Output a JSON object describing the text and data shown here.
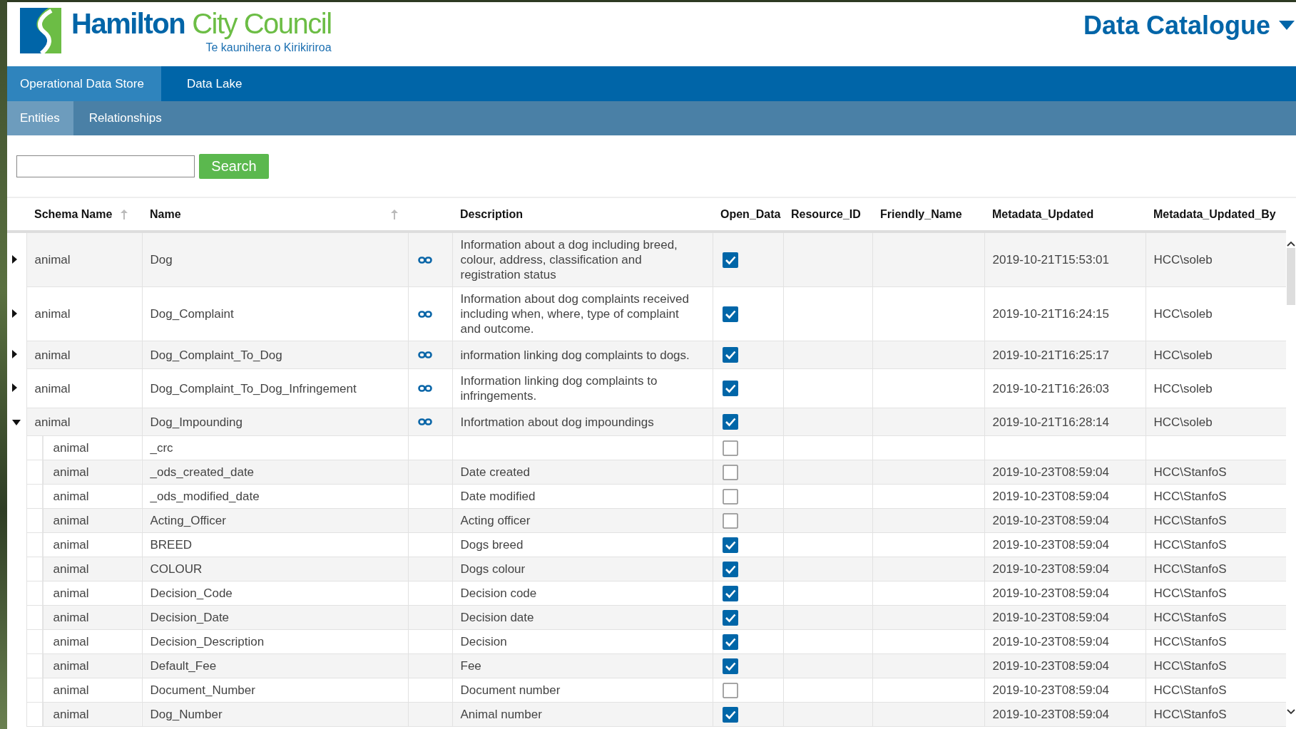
{
  "header": {
    "brand_primary": "Hamilton",
    "brand_secondary": "City Council",
    "brand_subtitle": "Te kaunihera o Kirikiriroa",
    "app_title": "Data Catalogue"
  },
  "nav_tabs": [
    {
      "label": "Operational Data Store",
      "selected": true
    },
    {
      "label": "Data Lake",
      "selected": false
    }
  ],
  "sub_tabs": [
    {
      "label": "Entities",
      "selected": true
    },
    {
      "label": "Relationships",
      "selected": false
    }
  ],
  "search": {
    "button": "Search"
  },
  "table": {
    "columns": [
      {
        "label": "Schema Name",
        "sort_icon": true
      },
      {
        "label": "Name",
        "sort_icon": true
      },
      {
        "label": "Description",
        "sort_icon": false
      },
      {
        "label": "Open_Data",
        "sort_icon": false
      },
      {
        "label": "Resource_ID",
        "sort_icon": false
      },
      {
        "label": "Friendly_Name",
        "sort_icon": false
      },
      {
        "label": "Metadata_Updated",
        "sort_icon": false
      },
      {
        "label": "Metadata_Updated_By",
        "sort_icon": false
      }
    ],
    "rows": [
      {
        "schema": "animal",
        "name": "Dog",
        "description": "Information about a dog including breed, colour, address, classification and registration status",
        "open_data": true,
        "metadata_updated": "2019-10-21T15:53:01",
        "metadata_updated_by": "HCC\\soleb",
        "expanded": false
      },
      {
        "schema": "animal",
        "name": "Dog_Complaint",
        "description": "Information about dog complaints received including when, where, type of complaint and outcome.",
        "open_data": true,
        "metadata_updated": "2019-10-21T16:24:15",
        "metadata_updated_by": "HCC\\soleb",
        "expanded": false
      },
      {
        "schema": "animal",
        "name": "Dog_Complaint_To_Dog",
        "description": "information linking dog complaints to dogs.",
        "open_data": true,
        "metadata_updated": "2019-10-21T16:25:17",
        "metadata_updated_by": "HCC\\soleb",
        "expanded": false
      },
      {
        "schema": "animal",
        "name": "Dog_Complaint_To_Dog_Infringement",
        "description": "Information linking dog complaints to infringements.",
        "open_data": true,
        "metadata_updated": "2019-10-21T16:26:03",
        "metadata_updated_by": "HCC\\soleb",
        "expanded": false
      },
      {
        "schema": "animal",
        "name": "Dog_Impounding",
        "description": "Infortmation about dog impoundings",
        "open_data": true,
        "metadata_updated": "2019-10-21T16:28:14",
        "metadata_updated_by": "HCC\\soleb",
        "expanded": true,
        "children": [
          {
            "schema": "animal",
            "name": "_crc",
            "open_data": false
          },
          {
            "schema": "animal",
            "name": "_ods_created_date",
            "description": "Date created",
            "open_data": false,
            "metadata_updated": "2019-10-23T08:59:04",
            "metadata_updated_by": "HCC\\StanfoS"
          },
          {
            "schema": "animal",
            "name": "_ods_modified_date",
            "description": "Date modified",
            "open_data": false,
            "metadata_updated": "2019-10-23T08:59:04",
            "metadata_updated_by": "HCC\\StanfoS"
          },
          {
            "schema": "animal",
            "name": "Acting_Officer",
            "description": "Acting officer",
            "open_data": false,
            "metadata_updated": "2019-10-23T08:59:04",
            "metadata_updated_by": "HCC\\StanfoS"
          },
          {
            "schema": "animal",
            "name": "BREED",
            "description": "Dogs breed",
            "open_data": true,
            "metadata_updated": "2019-10-23T08:59:04",
            "metadata_updated_by": "HCC\\StanfoS"
          },
          {
            "schema": "animal",
            "name": "COLOUR",
            "description": "Dogs colour",
            "open_data": true,
            "metadata_updated": "2019-10-23T08:59:04",
            "metadata_updated_by": "HCC\\StanfoS"
          },
          {
            "schema": "animal",
            "name": "Decision_Code",
            "description": "Decision code",
            "open_data": true,
            "metadata_updated": "2019-10-23T08:59:04",
            "metadata_updated_by": "HCC\\StanfoS"
          },
          {
            "schema": "animal",
            "name": "Decision_Date",
            "description": "Decision date",
            "open_data": true,
            "metadata_updated": "2019-10-23T08:59:04",
            "metadata_updated_by": "HCC\\StanfoS"
          },
          {
            "schema": "animal",
            "name": "Decision_Description",
            "description": "Decision",
            "open_data": true,
            "metadata_updated": "2019-10-23T08:59:04",
            "metadata_updated_by": "HCC\\StanfoS"
          },
          {
            "schema": "animal",
            "name": "Default_Fee",
            "description": "Fee",
            "open_data": true,
            "metadata_updated": "2019-10-23T08:59:04",
            "metadata_updated_by": "HCC\\StanfoS"
          },
          {
            "schema": "animal",
            "name": "Document_Number",
            "description": "Document number",
            "open_data": false,
            "metadata_updated": "2019-10-23T08:59:04",
            "metadata_updated_by": "HCC\\StanfoS"
          },
          {
            "schema": "animal",
            "name": "Dog_Number",
            "description": "Animal number",
            "open_data": true,
            "metadata_updated": "2019-10-23T08:59:04",
            "metadata_updated_by": "HCC\\StanfoS"
          }
        ]
      }
    ]
  }
}
